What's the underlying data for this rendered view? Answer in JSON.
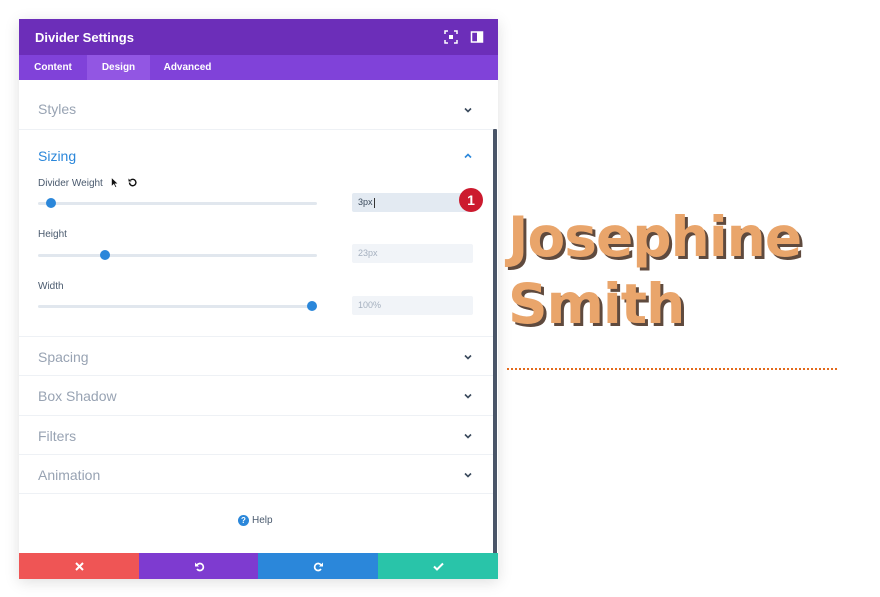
{
  "panel": {
    "title": "Divider Settings",
    "tabs": [
      {
        "label": "Content",
        "active": false
      },
      {
        "label": "Design",
        "active": true
      },
      {
        "label": "Advanced",
        "active": false
      }
    ],
    "sections": {
      "styles": "Styles",
      "sizing": "Sizing",
      "spacing": "Spacing",
      "box_shadow": "Box Shadow",
      "filters": "Filters",
      "animation": "Animation"
    },
    "sizing_fields": [
      {
        "label": "Divider Weight",
        "value": "3px",
        "slider_fraction": 0.05,
        "active": true
      },
      {
        "label": "Height",
        "value": "23px",
        "slider_fraction": 0.24,
        "active": false
      },
      {
        "label": "Width",
        "value": "100%",
        "slider_fraction": 1.0,
        "active": false
      }
    ],
    "annotation_badge": "1",
    "help_label": "Help",
    "colors": {
      "header": "#6c2eb9",
      "tabs": "#8042d9",
      "accent": "#2b87da",
      "cancel": "#ef5555",
      "undo": "#7e3bd0",
      "redo": "#2b87da",
      "save": "#29c4a9"
    }
  },
  "preview": {
    "name_line1": "Josephine",
    "name_line2": "Smith",
    "name_color": "#e9a56b",
    "divider_color": "#e36a1d"
  }
}
